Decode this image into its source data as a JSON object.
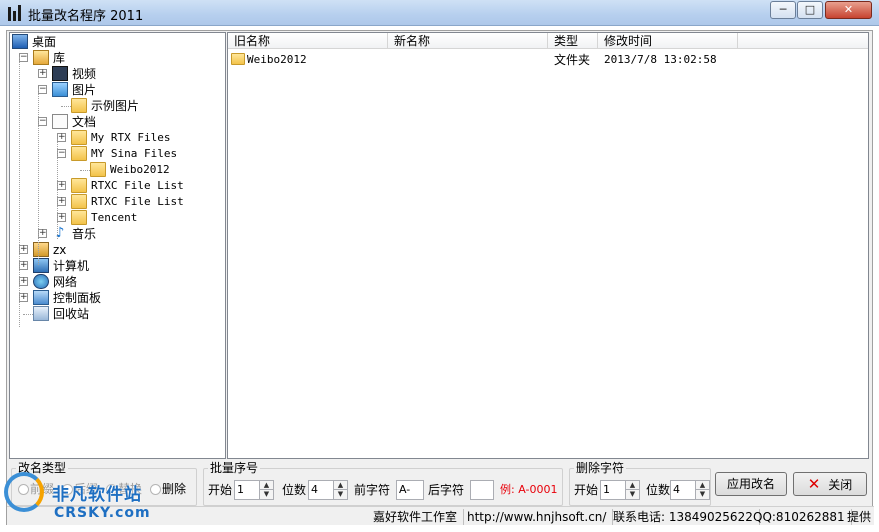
{
  "window": {
    "title": "批量改名程序 2011",
    "min_label": "─",
    "max_label": "□",
    "close_label": "✕"
  },
  "tree": {
    "expand_plus": "+",
    "expand_minus": "−",
    "items": [
      {
        "label": "桌面",
        "icon": "desktop-icon"
      },
      {
        "label": "库",
        "icon": "library-icon"
      },
      {
        "label": "视频",
        "icon": "video-library-icon"
      },
      {
        "label": "图片",
        "icon": "pictures-library-icon"
      },
      {
        "label": "示例图片",
        "icon": "folder-icon"
      },
      {
        "label": "文档",
        "icon": "documents-library-icon"
      },
      {
        "label": "My RTX Files",
        "icon": "folder-icon"
      },
      {
        "label": "MY Sina Files",
        "icon": "folder-icon"
      },
      {
        "label": "Weibo2012",
        "icon": "folder-icon"
      },
      {
        "label": "RTXC File List",
        "icon": "folder-icon"
      },
      {
        "label": "RTXC File List",
        "icon": "folder-icon"
      },
      {
        "label": "Tencent",
        "icon": "folder-icon"
      },
      {
        "label": "音乐",
        "icon": "music-library-icon"
      },
      {
        "label": "zx",
        "icon": "user-folder-icon"
      },
      {
        "label": "计算机",
        "icon": "computer-icon"
      },
      {
        "label": "网络",
        "icon": "network-icon"
      },
      {
        "label": "控制面板",
        "icon": "control-panel-icon"
      },
      {
        "label": "回收站",
        "icon": "recycle-bin-icon"
      }
    ]
  },
  "list": {
    "columns": [
      "旧名称",
      "新名称",
      "类型",
      "修改时间"
    ],
    "rows": [
      {
        "old_name": "Weibo2012",
        "new_name": "",
        "type": "文件夹",
        "modified": "2013/7/8 13:02:58"
      }
    ]
  },
  "rename_type": {
    "legend": "改名类型",
    "options": [
      "前缀",
      "后缀",
      "替换",
      "删除"
    ]
  },
  "batch_number": {
    "legend": "批量序号",
    "start_label": "开始",
    "start_value": "1",
    "digits_label": "位数",
    "digits_value": "4",
    "prefix_label": "前字符",
    "prefix_value": "A-",
    "suffix_label": "后字符",
    "suffix_value": "",
    "example": "例: A-0001"
  },
  "delete_chars": {
    "legend": "删除字符",
    "start_label": "开始",
    "start_value": "1",
    "digits_label": "位数",
    "digits_value": "4"
  },
  "buttons": {
    "apply": "应用改名",
    "close": "关闭"
  },
  "status": {
    "studio": "嘉好软件工作室",
    "url": "http://www.hnjhsoft.cn/",
    "phone": "联系电话: 13849025622",
    "qq": "QQ:810262881",
    "provide": "提供"
  },
  "watermark": {
    "cn": "非凡软件站",
    "en": "CRSKY.com"
  }
}
